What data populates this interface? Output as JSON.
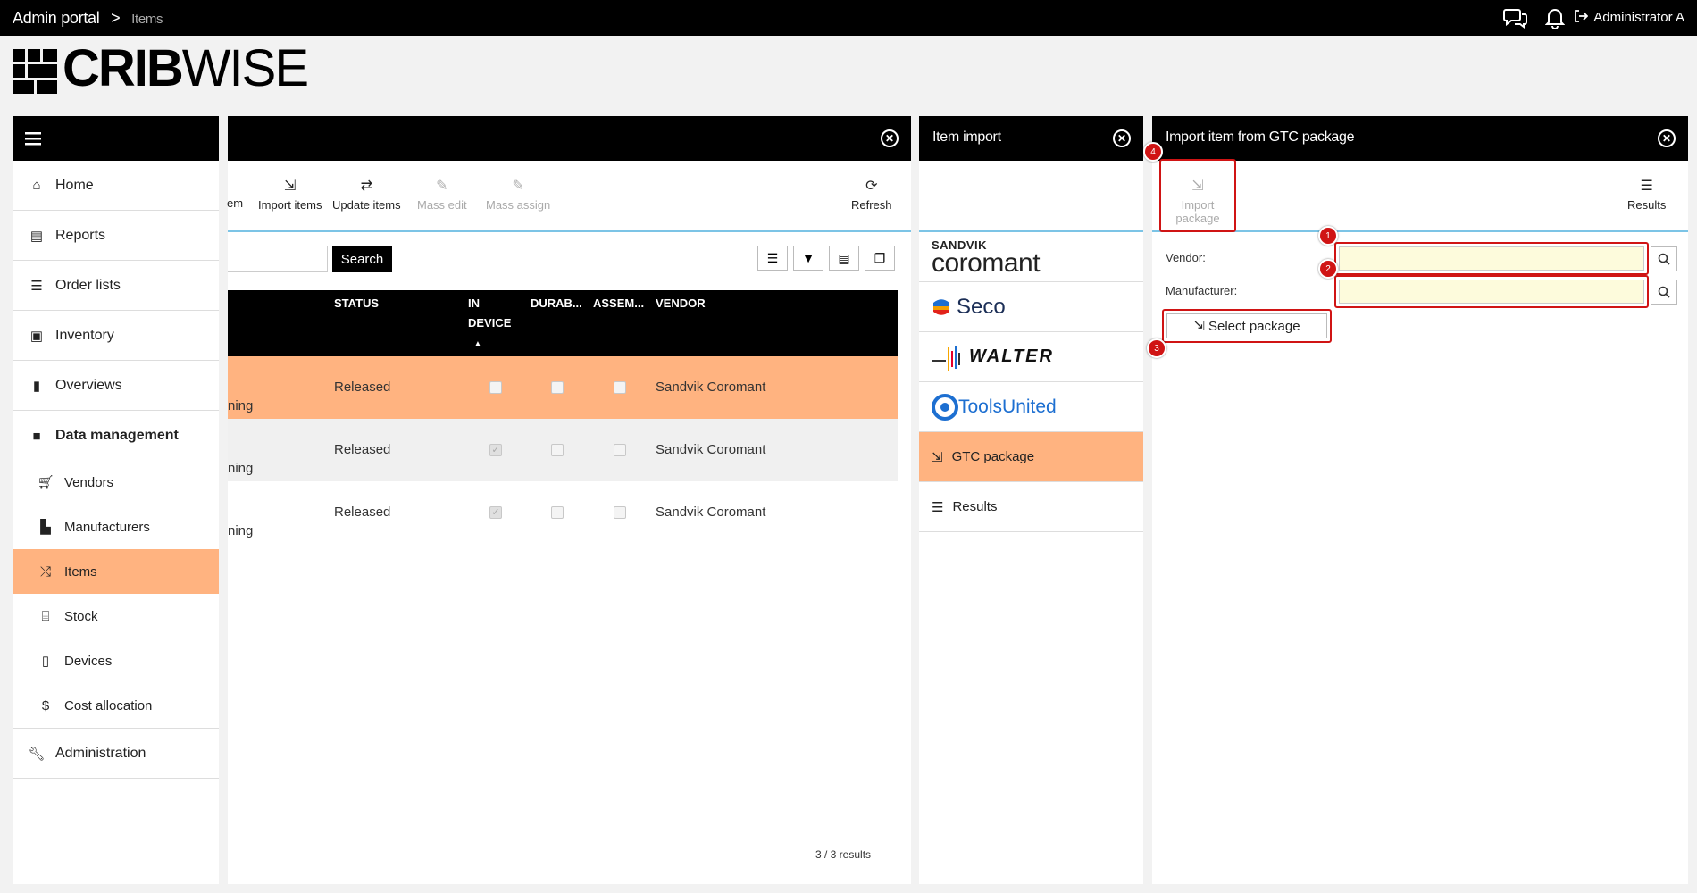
{
  "topbar": {
    "breadcrumb_root": "Admin portal",
    "breadcrumb_sep": ">",
    "breadcrumb_current": "Items",
    "user": "Administrator A"
  },
  "logo": {
    "bold": "CRIB",
    "light": "WISE"
  },
  "sidebar": {
    "items": [
      {
        "label": "Home",
        "icon": "home-icon"
      },
      {
        "label": "Reports",
        "icon": "printer-icon"
      },
      {
        "label": "Order lists",
        "icon": "list-icon"
      },
      {
        "label": "Inventory",
        "icon": "clipboard-icon"
      },
      {
        "label": "Overviews",
        "icon": "bar-chart-icon"
      },
      {
        "label": "Data management",
        "icon": "briefcase-icon"
      }
    ],
    "sub_items": [
      {
        "label": "Vendors",
        "icon": "cart-icon"
      },
      {
        "label": "Manufacturers",
        "icon": "factory-icon"
      },
      {
        "label": "Items",
        "icon": "shuffle-icon"
      },
      {
        "label": "Stock",
        "icon": "warehouse-icon"
      },
      {
        "label": "Devices",
        "icon": "device-icon"
      },
      {
        "label": "Cost allocation",
        "icon": "dollar-icon"
      }
    ],
    "admin": {
      "label": "Administration",
      "icon": "wrench-icon"
    }
  },
  "items_panel": {
    "toolbar": {
      "partial": "em",
      "import": "Import items",
      "update": "Update items",
      "mass_edit": "Mass edit",
      "mass_assign": "Mass assign",
      "refresh": "Refresh"
    },
    "search_label": "Search",
    "columns": [
      "STATUS",
      "IN",
      "DEVICE",
      "DURAB...",
      "ASSEM...",
      "VENDOR"
    ],
    "rows": [
      {
        "partial": "ning",
        "status": "Released",
        "in_device": false,
        "durable": false,
        "assembly": false,
        "vendor": "Sandvik Coromant"
      },
      {
        "partial": "ning",
        "status": "Released",
        "in_device": true,
        "durable": false,
        "assembly": false,
        "vendor": "Sandvik Coromant"
      },
      {
        "partial": "ning",
        "status": "Released",
        "in_device": true,
        "durable": false,
        "assembly": false,
        "vendor": "Sandvik Coromant"
      }
    ],
    "results": "3 / 3 results"
  },
  "import_panel": {
    "title": "Item import",
    "sandvik_top": "SANDVIK",
    "sandvik_bottom": "coromant",
    "seco": "Seco",
    "walter": "WALTER",
    "toolsunited": "ToolsUnited",
    "gtc": "GTC package",
    "results": "Results"
  },
  "gtc_panel": {
    "title": "Import item from GTC package",
    "import_label_1": "Import",
    "import_label_2": "package",
    "results": "Results",
    "vendor_label": "Vendor:",
    "manufacturer_label": "Manufacturer:",
    "select_package": "Select package",
    "badges": [
      "1",
      "2",
      "3",
      "4"
    ]
  },
  "colors": {
    "accent": "#ffb380",
    "highlight": "#d01414",
    "field": "#fdfbdc"
  }
}
